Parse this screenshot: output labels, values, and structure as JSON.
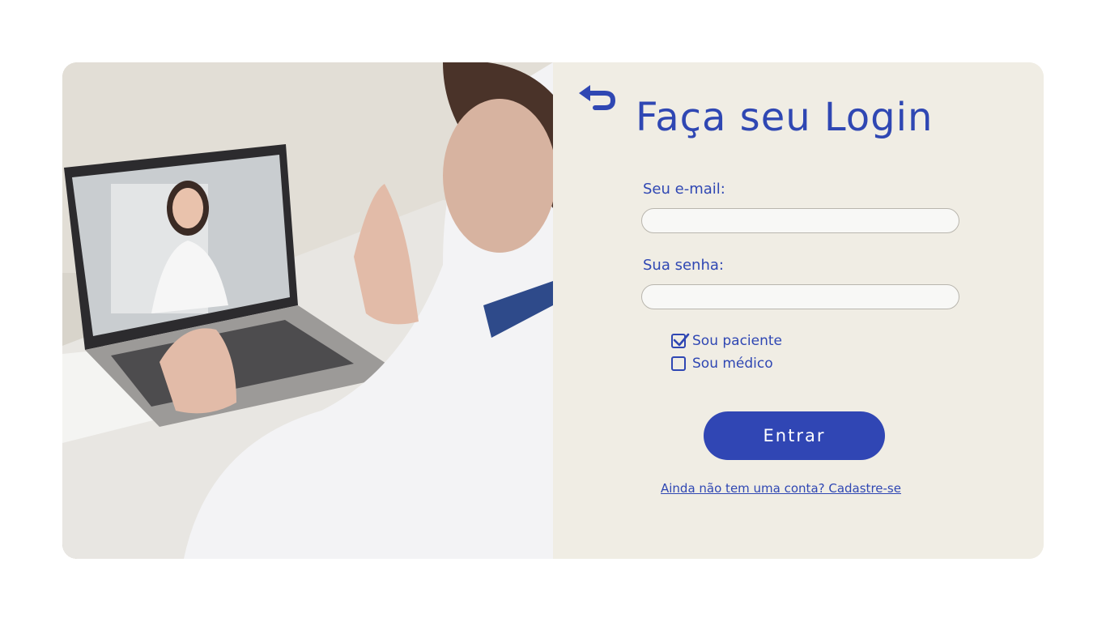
{
  "login": {
    "title": "Faça seu Login",
    "email_label": "Seu e-mail:",
    "email_value": "",
    "password_label": "Sua senha:",
    "password_value": "",
    "roles": [
      {
        "label": "Sou paciente",
        "checked": true
      },
      {
        "label": "Sou médico",
        "checked": false
      }
    ],
    "submit_label": "Entrar",
    "signup_link": "Ainda não tem uma conta? Cadastre-se"
  },
  "icons": {
    "back": "back-arrow-icon",
    "checkbox_checked": "checkmark-icon"
  },
  "colors": {
    "brand": "#3046b4",
    "panel_background": "#f0ede4",
    "page_background": "#ffffff"
  }
}
